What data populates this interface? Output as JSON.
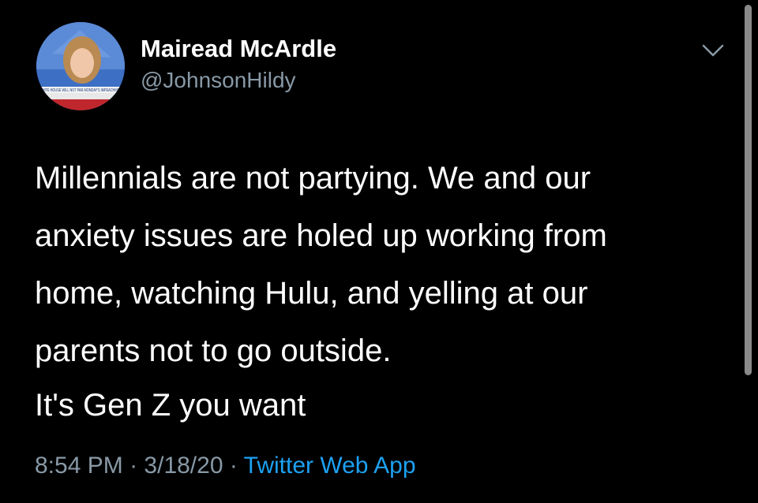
{
  "tweet": {
    "author_name": "Mairead McArdle",
    "author_handle": "@JohnsonHildy",
    "avatar_caption": "WHITE HOUSE WILL NOT PAR MONDAY'S IMPEACHMEN",
    "body_lines": [
      "Millennials are not partying. We and our",
      "anxiety issues are holed up working from",
      "home, watching Hulu, and yelling at our",
      "parents not to go outside."
    ],
    "body_second_paragraph": "It's Gen Z you want",
    "time": "8:54 PM",
    "separator": "·",
    "date": "3/18/20",
    "source": "Twitter Web App"
  },
  "icons": {
    "menu": "chevron-down-icon"
  },
  "colors": {
    "background": "#000000",
    "text_primary": "#ffffff",
    "text_secondary": "#8899a6",
    "link": "#1da1f2"
  }
}
